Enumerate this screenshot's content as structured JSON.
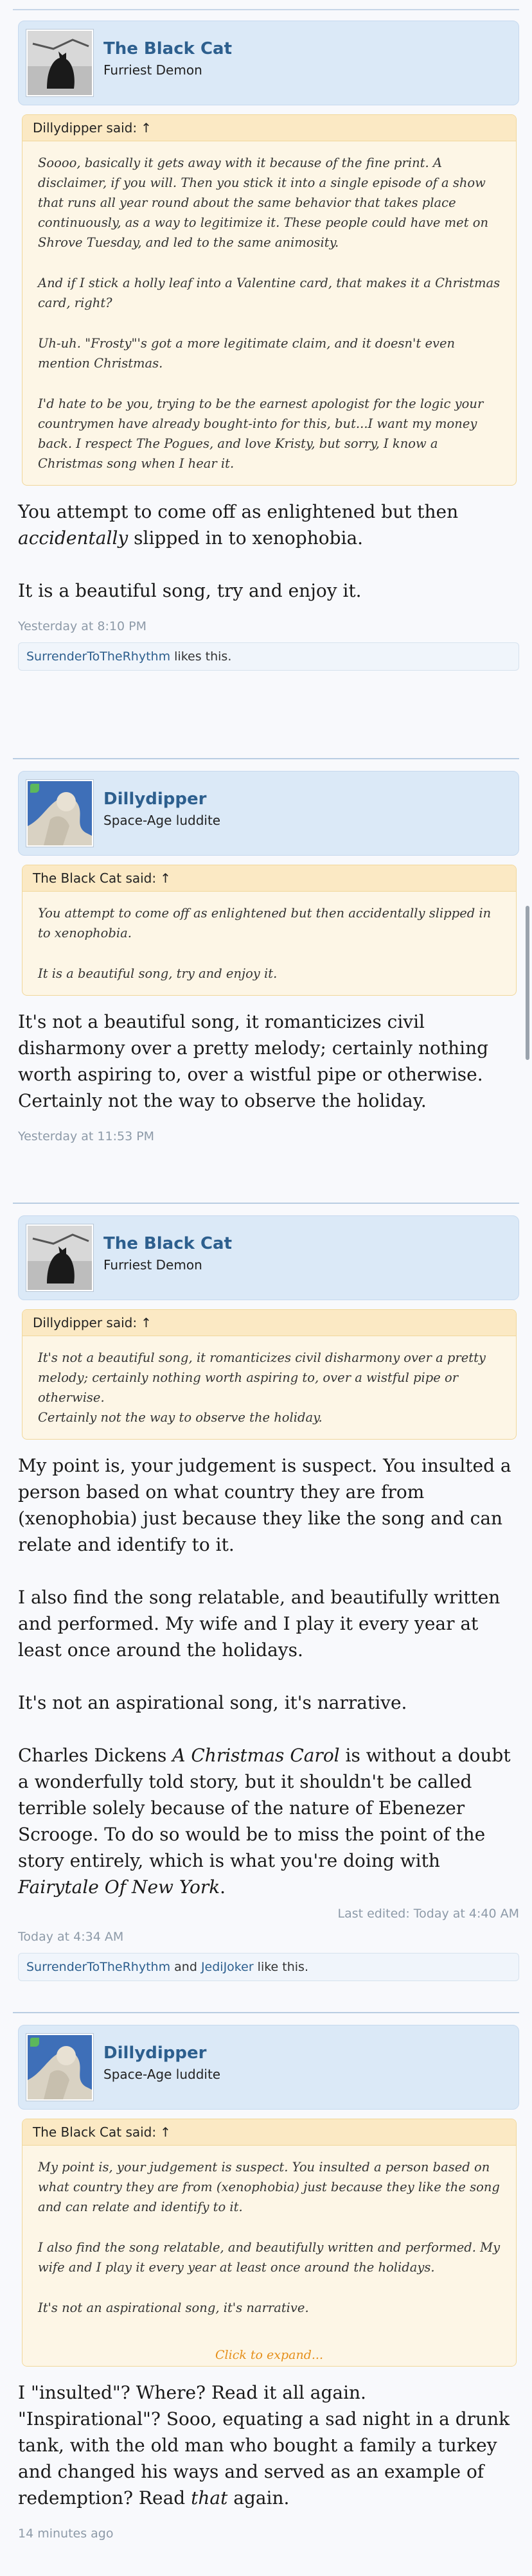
{
  "posts": [
    {
      "user": {
        "name": "The Black Cat",
        "title": "Furriest Demon",
        "online": false
      },
      "quote": {
        "author": "Dillydipper said:",
        "arrow": "↑",
        "paragraphs": [
          "Soooo, basically it gets away with it because of the fine print. A disclaimer, if you will. Then you stick it into a single episode of a show that runs all year round about the same behavior that takes place continuously, as a way to legitimize it. These people could have met on Shrove Tuesday, and led to the same animosity.",
          "And if I stick a holly leaf into a Valentine card, that makes it a Christmas card, right?",
          "Uh-uh. \"Frosty\"'s got a more legitimate claim, and it doesn't even mention Christmas.",
          "I'd hate to be you, trying to be the earnest apologist for the logic your countrymen have already bought-into for this, but...I want my money back. I respect The Pogues, and love Kristy, but sorry, I know a Christmas song when I hear it."
        ]
      },
      "message": {
        "p1_a": "You attempt to come off as enlightened but then ",
        "p1_em": "accidentally",
        "p1_b": " slipped in to xenophobia.",
        "p2": "It is a beautiful song, try and enjoy it."
      },
      "time": "Yesterday at 8:10 PM",
      "likes": {
        "users": [
          "SurrenderToTheRhythm"
        ],
        "suffix": " likes this."
      }
    },
    {
      "user": {
        "name": "Dillydipper",
        "title": "Space-Age luddite",
        "online": true
      },
      "quote": {
        "author": "The Black Cat said:",
        "arrow": "↑",
        "paragraphs": [
          "You attempt to come off as enlightened but then accidentally slipped in to xenophobia.",
          "It is a beautiful song, try and enjoy it."
        ]
      },
      "message": {
        "lines": [
          "It's not a beautiful song, it romanticizes civil disharmony over a pretty melody; certainly nothing worth aspiring to, over a wistful pipe or otherwise.",
          "Certainly not the way to observe the holiday."
        ]
      },
      "time": "Yesterday at 11:53 PM"
    },
    {
      "user": {
        "name": "The Black Cat",
        "title": "Furriest Demon",
        "online": false
      },
      "quote": {
        "author": "Dillydipper said:",
        "arrow": "↑",
        "lines": [
          "It's not a beautiful song, it romanticizes civil disharmony over a pretty melody; certainly nothing worth aspiring to, over a wistful pipe or otherwise.",
          "Certainly not the way to observe the holiday."
        ]
      },
      "message": {
        "p1": "My point is, your judgement is suspect. You insulted a person based on what country they are from (xenophobia) just because they like the song and can relate and identify to it.",
        "p2": "I also find the song relatable, and beautifully written and performed. My wife and I play it every year at least once around the holidays.",
        "p3": "It's not an aspirational song, it's narrative.",
        "p4_a": "Charles Dickens ",
        "p4_em1": "A Christmas Carol",
        "p4_b": " is without a doubt a wonderfully told story, but it shouldn't be called terrible solely because of the nature of Ebenezer Scrooge. To do so would be to miss the point of the story entirely, which is what you're doing with ",
        "p4_em2": "Fairytale Of New York",
        "p4_c": "."
      },
      "edited": "Last edited: Today at 4:40 AM",
      "time": "Today at 4:34 AM",
      "likes": {
        "users": [
          "SurrenderToTheRhythm",
          "JediJoker"
        ],
        "joiner": " and ",
        "suffix": " like this."
      }
    },
    {
      "user": {
        "name": "Dillydipper",
        "title": "Space-Age luddite",
        "online": true
      },
      "quote": {
        "author": "The Black Cat said:",
        "arrow": "↑",
        "paragraphs": [
          "My point is, your judgement is suspect. You insulted a person based on what country they are from (xenophobia) just because they like the song and can relate and identify to it.",
          "I also find the song relatable, and beautifully written and performed. My wife and I play it every year at least once around the holidays.",
          "It's not an aspirational song, it's narrative."
        ],
        "expand": "Click to expand..."
      },
      "message": {
        "l1": "I \"insulted\"? Where? Read it all again.",
        "l2": "\"Inspirational\"? Sooo, equating a sad night in a drunk tank, with the old man who bought a family a turkey and changed his ways and served as an example of redemption? Read ",
        "l2_em": "that",
        "l2_c": " again."
      },
      "time": "14 minutes ago"
    }
  ]
}
